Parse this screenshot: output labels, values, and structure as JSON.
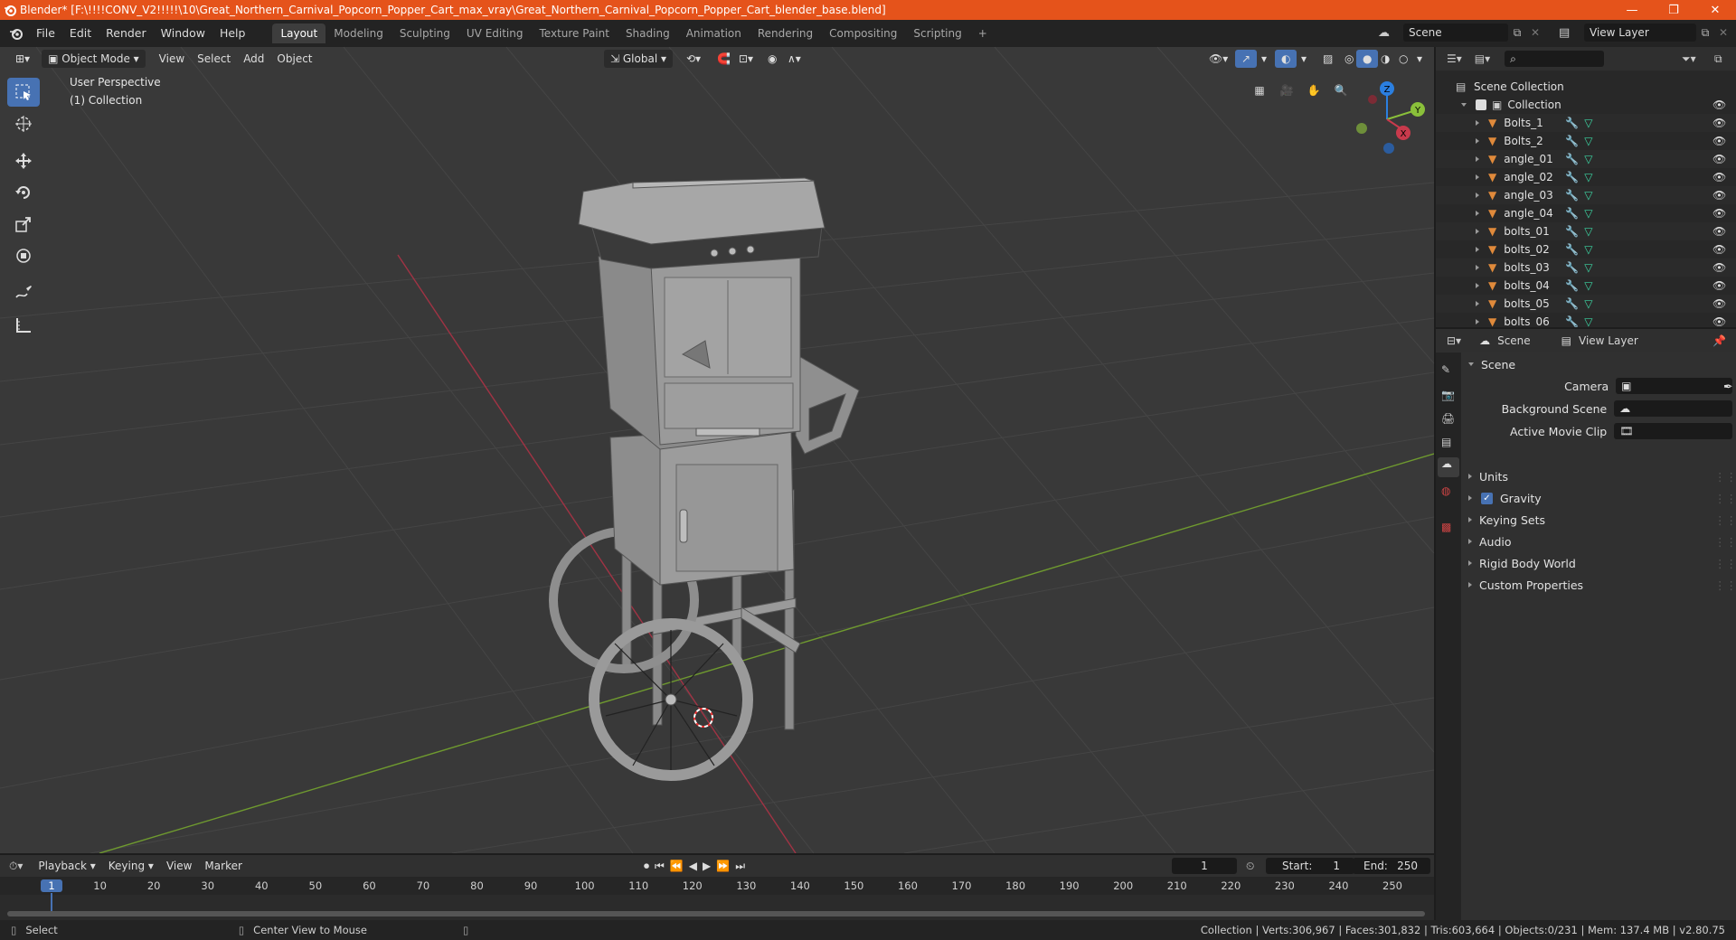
{
  "window": {
    "title": "Blender* [F:\\!!!!CONV_V2!!!!!\\10\\Great_Northern_Carnival_Popcorn_Popper_Cart_max_vray\\Great_Northern_Carnival_Popcorn_Popper_Cart_blender_base.blend]",
    "minimize": "—",
    "maximize": "❐",
    "close": "✕"
  },
  "menu": [
    "File",
    "Edit",
    "Render",
    "Window",
    "Help"
  ],
  "workspaces": [
    "Layout",
    "Modeling",
    "Sculpting",
    "UV Editing",
    "Texture Paint",
    "Shading",
    "Animation",
    "Rendering",
    "Compositing",
    "Scripting"
  ],
  "workspace_add": "+",
  "scene_field": "Scene",
  "viewlayer_field": "View Layer",
  "viewport": {
    "mode": "Object Mode",
    "menus": [
      "View",
      "Select",
      "Add",
      "Object"
    ],
    "orientation": "Global",
    "perspective_label": "User Perspective",
    "collection_label": "(1) Collection",
    "gizmo": {
      "x": "X",
      "y": "Y",
      "z": "Z"
    }
  },
  "outliner": {
    "root": "Scene Collection",
    "collection": "Collection",
    "items": [
      "Bolts_1",
      "Bolts_2",
      "angle_01",
      "angle_02",
      "angle_03",
      "angle_04",
      "bolts_01",
      "bolts_02",
      "bolts_03",
      "bolts_04",
      "bolts_05",
      "bolts_06"
    ]
  },
  "properties": {
    "tab_scene": "Scene",
    "tab_viewlayer": "View Layer",
    "panel_title": "Scene",
    "camera_label": "Camera",
    "background_scene_label": "Background Scene",
    "active_movie_clip_label": "Active Movie Clip",
    "sections": [
      "Units",
      "Gravity",
      "Keying Sets",
      "Audio",
      "Rigid Body World",
      "Custom Properties"
    ]
  },
  "timeline": {
    "menus": [
      "Playback",
      "Keying",
      "View",
      "Marker"
    ],
    "current_frame": "1",
    "start_label": "Start:",
    "start_value": "1",
    "end_label": "End:",
    "end_value": "250",
    "ruler": [
      "1",
      "10",
      "20",
      "30",
      "40",
      "50",
      "60",
      "70",
      "80",
      "90",
      "100",
      "110",
      "120",
      "130",
      "140",
      "150",
      "160",
      "170",
      "180",
      "190",
      "200",
      "210",
      "220",
      "230",
      "240",
      "250"
    ]
  },
  "statusbar": {
    "select": "Select",
    "center_view": "Center View to Mouse",
    "stats": "Collection | Verts:306,967 | Faces:301,832 | Tris:603,664 | Objects:0/231 | Mem: 137.4 MB | v2.80.75"
  },
  "colors": {
    "titlebar": "#e5531b",
    "accent": "#4772b3",
    "x_axis": "#c93a4c",
    "y_axis": "#8ac03a",
    "z_axis": "#2b7fe0"
  }
}
